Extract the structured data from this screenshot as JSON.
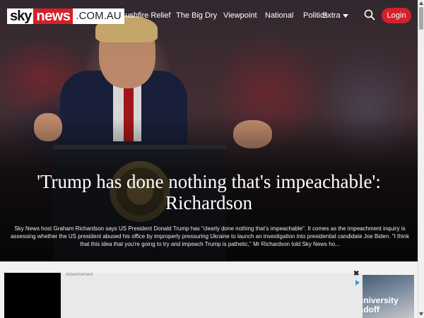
{
  "brand": {
    "sky": "sky",
    "news": "news",
    "domain": ".COM.AU"
  },
  "nav": {
    "items": [
      "Bushfire Relief",
      "The Big Dry",
      "Viewpoint",
      "National",
      "Politics",
      "Extra"
    ],
    "search_icon": "search-icon",
    "login_label": "Login"
  },
  "article": {
    "headline_line1": "'Trump has done nothing that's impeachable':",
    "headline_line2": "Richardson",
    "summary": "Sky News host Graham Richardson says US President Donald Trump has \"clearly done nothing that's impeachable\". It comes as the impeachment inquiry is assessing whether the US president abused his office by improperly pressuring Ukraine to launch an investigation into presidential candidate Joe Biden. \"I think that this idea that you're going to try and impeach Trump is pathetic,\" Mr Richardson told Sky News ho..."
  },
  "ad": {
    "label": "Advertisement",
    "close": "✖",
    "thumb_line1": "university",
    "thumb_line2": "ndoff"
  },
  "colors": {
    "brand_red": "#d4202a",
    "accent_blue": "#2aa1d8"
  }
}
